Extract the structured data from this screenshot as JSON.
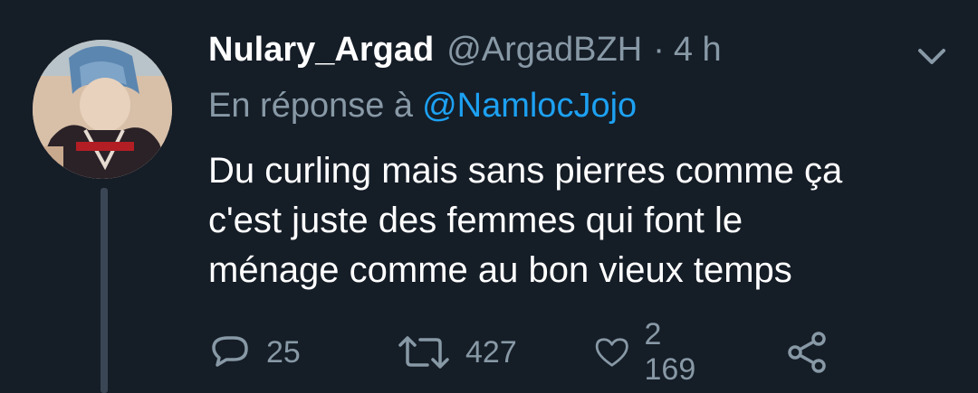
{
  "tweet": {
    "display_name": "Nulary_Argad",
    "handle": "@ArgadBZH",
    "separator": "·",
    "time": "4 h",
    "reply_prefix": "En réponse à",
    "reply_mention": "@NamlocJojo",
    "text_lines": [
      "Du curling mais sans pierres comme ça",
      "c'est juste des femmes qui font le",
      "ménage comme au bon vieux temps"
    ]
  },
  "actions": {
    "replies": "25",
    "retweets": "427",
    "likes": "2 169"
  },
  "icons": {
    "menu": "chevron-down-icon",
    "reply": "reply-icon",
    "retweet": "retweet-icon",
    "like": "heart-icon",
    "share": "share-icon"
  },
  "colors": {
    "background": "#151d27",
    "primary_text": "#ffffff",
    "secondary_text": "#8899a6",
    "link": "#1da1f2",
    "thread_line": "#3a4654"
  }
}
